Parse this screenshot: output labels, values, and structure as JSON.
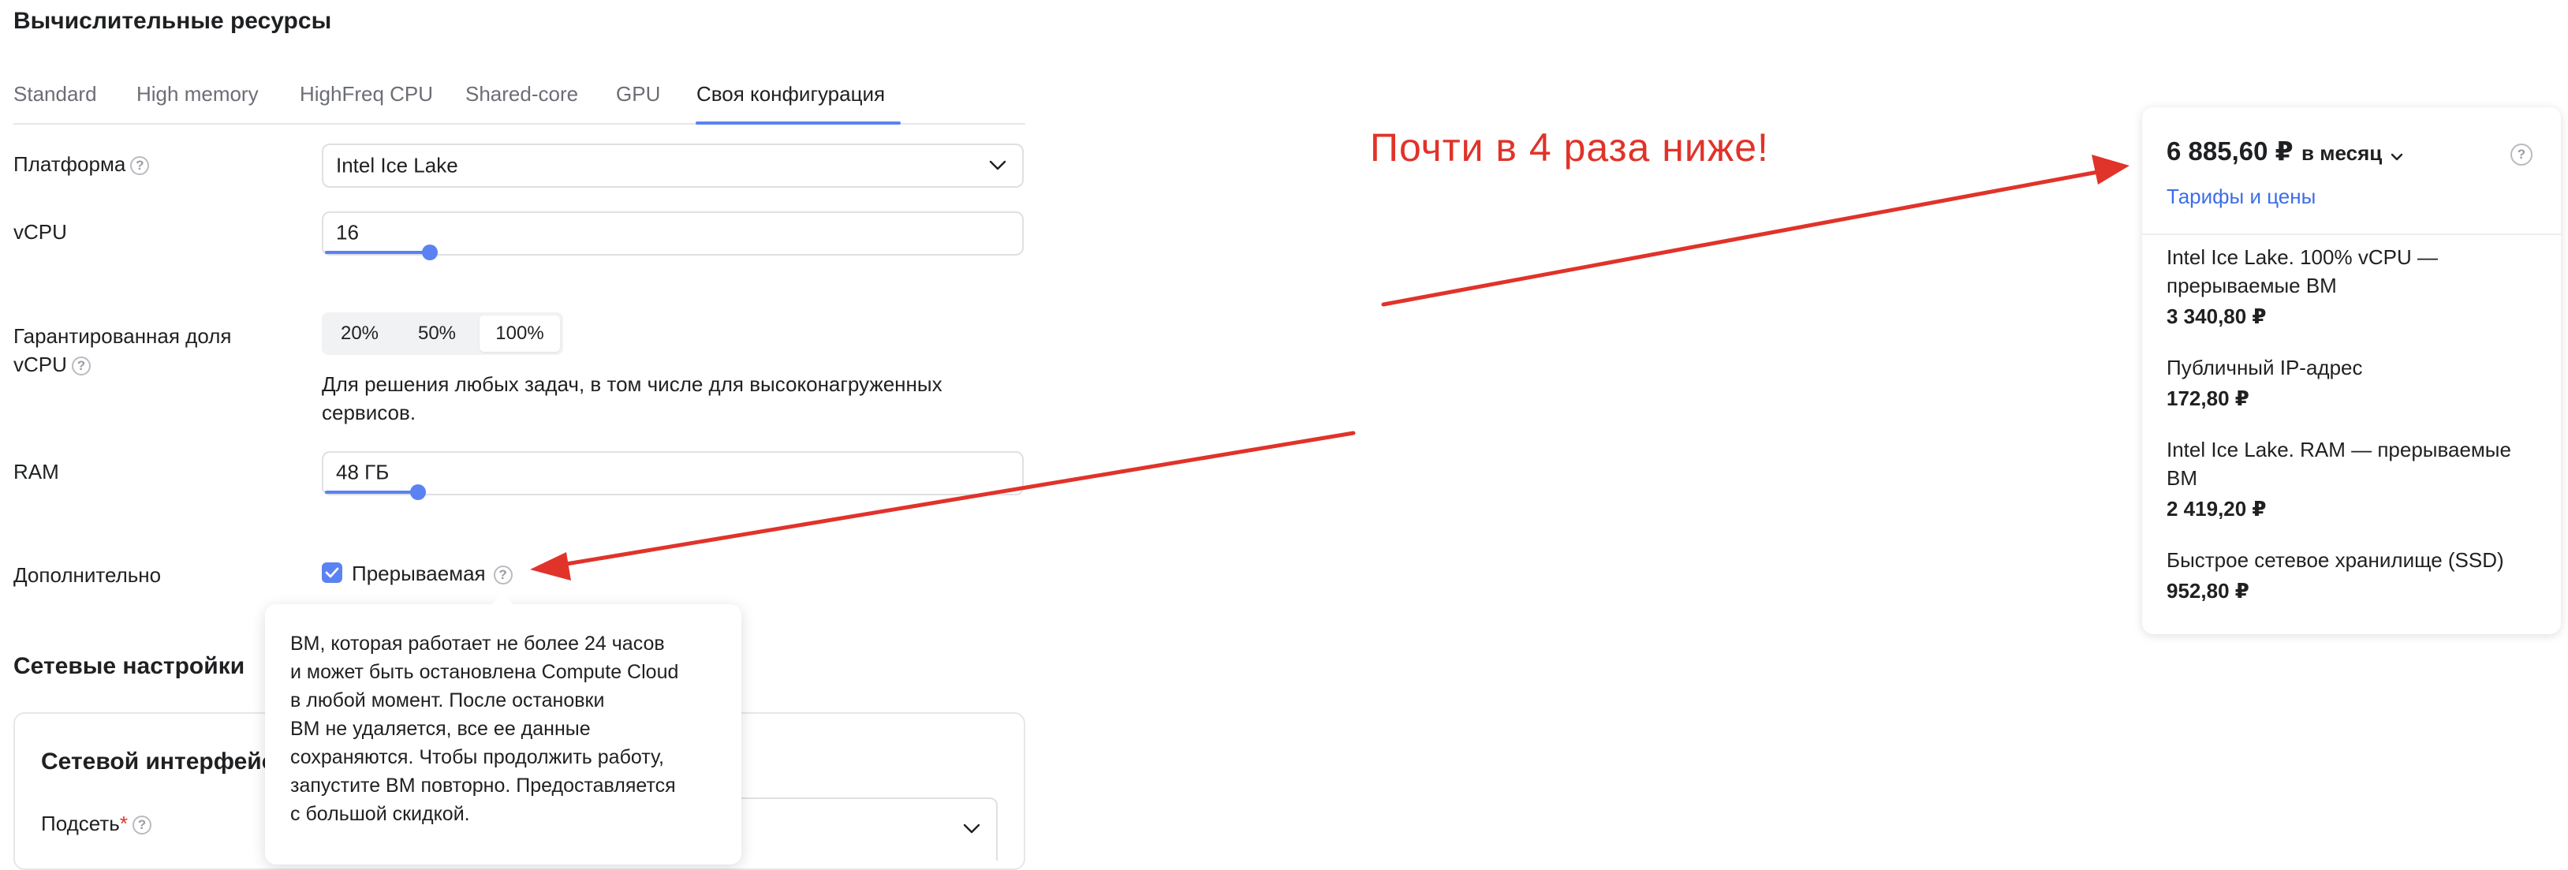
{
  "section_title": "Вычислительные ресурсы",
  "tabs": [
    {
      "label": "Standard"
    },
    {
      "label": "High memory"
    },
    {
      "label": "HighFreq CPU"
    },
    {
      "label": "Shared-core"
    },
    {
      "label": "GPU"
    },
    {
      "label": "Своя конфигурация",
      "active": true
    }
  ],
  "platform": {
    "label": "Платформа",
    "value": "Intel Ice Lake"
  },
  "vcpu": {
    "label": "vCPU",
    "value": "16",
    "slider_fraction": 0.14
  },
  "guaranteed_share": {
    "label_line1": "Гарантированная доля",
    "label_line2": "vCPU",
    "options": [
      "20%",
      "50%",
      "100%"
    ],
    "selected": "100%",
    "hint_line1": "Для решения любых задач, в том числе для высоконагруженных",
    "hint_line2": "сервисов."
  },
  "ram": {
    "label": "RAM",
    "value": "48 ГБ",
    "slider_fraction": 0.12
  },
  "additional": {
    "label": "Дополнительно",
    "preemptible_label": "Прерываемая",
    "preemptible_checked": true
  },
  "tooltip": {
    "lines": [
      "ВМ, которая работает не более 24 часов",
      "и может быть остановлена Compute Cloud",
      "в любой момент. После остановки",
      "ВМ не удаляется, все ее данные",
      "сохраняются. Чтобы продолжить работу,",
      "запустите ВМ повторно. Предоставляется",
      "с большой скидкой."
    ]
  },
  "network": {
    "section_title": "Сетевые настройки",
    "interface_title": "Сетевой интерфейс",
    "subnet_label": "Подсеть",
    "required_mark": "*"
  },
  "annotation": {
    "text": "Почти в 4 раза ниже!",
    "color": "#e0332a"
  },
  "pricing": {
    "total": "6 885,60 ₽",
    "period": "в месяц",
    "tariffs_link": "Тарифы и цены",
    "items": [
      {
        "name_line1": "Intel Ice Lake. 100% vCPU —",
        "name_line2": "прерываемые ВМ",
        "price": "3 340,80 ₽"
      },
      {
        "name_line1": "Публичный IP-адрес",
        "name_line2": "",
        "price": "172,80 ₽"
      },
      {
        "name_line1": "Intel Ice Lake. RAM — прерываемые",
        "name_line2": "ВМ",
        "price": "2 419,20 ₽"
      },
      {
        "name_line1": "Быстрое сетевое хранилище (SSD)",
        "name_line2": "",
        "price": "952,80 ₽"
      }
    ]
  },
  "colors": {
    "accent": "#5a82f2",
    "link": "#3d6ee6",
    "annotation": "#e0332a"
  }
}
